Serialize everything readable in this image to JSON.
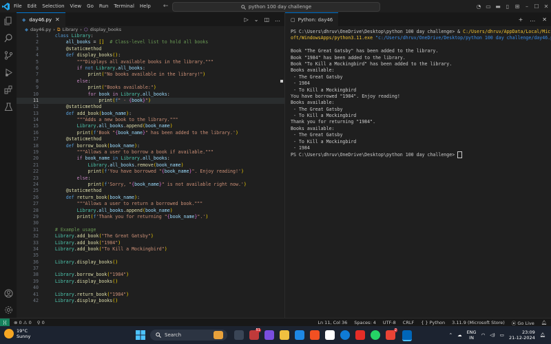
{
  "titlebar": {
    "menu": [
      "File",
      "Edit",
      "Selection",
      "View",
      "Go",
      "Run",
      "Terminal",
      "Help"
    ],
    "search": "python 100 day challenge"
  },
  "editor": {
    "tab": "day46.py",
    "breadcrumb": [
      "day46.py",
      "Library",
      "display_books"
    ],
    "current_line": 11
  },
  "terminal": {
    "tab": "Python: day46",
    "prompt_path": "PS C:\\Users\\dhruv\\OneDrive\\Desktop\\python 100 day challenge>",
    "cmd1_exe": "C:/Users/dhruv/AppData/Local/Micros",
    "cmd2_exe": "oft/WindowsApps/python3.11.exe",
    "cmd2_arg": "\"c:/Users/dhruv/OneDrive/Desktop/python 100 day challenge/day46.py\"",
    "output": [
      "Book \"The Great Gatsby\" has been added to the library.",
      "Book \"1984\" has been added to the library.",
      "Book \"To Kill a Mockingbird\" has been added to the library.",
      "Books available:",
      " - The Great Gatsby",
      " - 1984",
      " - To Kill a Mockingbird",
      "You have borrowed \"1984\". Enjoy reading!",
      "Books available:",
      " - The Great Gatsby",
      " - To Kill a Mockingbird",
      "Thank you for returning \"1984\".",
      "Books available:",
      " - The Great Gatsby",
      " - To Kill a Mockingbird",
      " - 1984"
    ]
  },
  "statusbar": {
    "errors": "0",
    "warnings": "0",
    "ports": "0",
    "position": "Ln 11, Col 36",
    "spaces": "Spaces: 4",
    "encoding": "UTF-8",
    "eol": "CRLF",
    "language": "Python",
    "interpreter": "3.11.9 (Microsoft Store)",
    "golive": "Go Live"
  },
  "taskbar": {
    "temp": "19°C",
    "condition": "Sunny",
    "search": "Search",
    "lang": "ENG",
    "region": "IN",
    "time": "23:09",
    "date": "21-12-2024",
    "badge1": "51",
    "badge2": "2"
  },
  "colors": {
    "accent": "#0078d4",
    "statusRemote": "#16825d",
    "path": "#f1c232"
  }
}
